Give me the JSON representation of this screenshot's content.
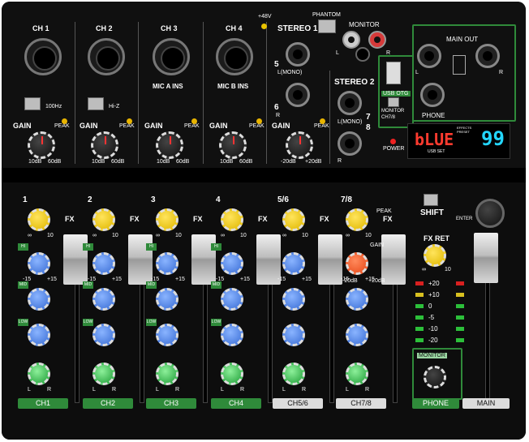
{
  "top": {
    "channels": [
      {
        "name": "CH 1",
        "switch": "100Hz",
        "gain": "GAIN",
        "peak": "PEAK",
        "min": "10dB",
        "max": "60dB"
      },
      {
        "name": "CH 2",
        "switch": "Hi-Z",
        "gain": "GAIN",
        "peak": "PEAK",
        "min": "10dB",
        "max": "60dB"
      },
      {
        "name": "CH 3",
        "sub": "MIC A INS",
        "gain": "GAIN",
        "peak": "PEAK",
        "min": "10dB",
        "max": "60dB"
      },
      {
        "name": "CH 4",
        "sub": "MIC B INS",
        "gain": "GAIN",
        "peak": "PEAK",
        "min": "10dB",
        "max": "60dB"
      }
    ],
    "phantom_volt": "+48V",
    "phantom": "PHANTOM",
    "stereo1": "STEREO 1",
    "stereo1_mono": "L(MONO)",
    "stereo1_r": "R",
    "stereo1_num_a": "5",
    "stereo1_num_b": "6",
    "stereo1_gain": "GAIN",
    "stereo1_peak": "PEAK",
    "stereo1_min": "-20dB",
    "stereo1_max": "+20dB",
    "monitor": "MONITOR",
    "monitor_l": "L",
    "monitor_r": "R",
    "stereo2": "STEREO 2",
    "stereo2_mono": "L(MONO)",
    "stereo2_r": "R",
    "stereo2_num_a": "7",
    "stereo2_num_b": "8",
    "usb": "USB OTG",
    "usb_monitor": "MONITOR",
    "usb_ch": "CH7/8",
    "power": "POWER",
    "main_out": "MAIN OUT",
    "main_l": "L",
    "main_r": "R",
    "phone": "PHONE",
    "display_text": "bLUE",
    "display_num": "99",
    "effects_preset": "EFFECTS PRESET",
    "usb_set": "USB SET"
  },
  "bottom": {
    "channels": [
      {
        "num": "1",
        "label": "CH1"
      },
      {
        "num": "2",
        "label": "CH2"
      },
      {
        "num": "3",
        "label": "CH3"
      },
      {
        "num": "4",
        "label": "CH4"
      },
      {
        "num": "5/6",
        "label": "CH5/6"
      },
      {
        "num": "7/8",
        "label": "CH7/8"
      }
    ],
    "fx": "FX",
    "peak": "PEAK",
    "gain": "GAIN",
    "hi": "HI",
    "mid": "MID",
    "low": "LOW",
    "shift": "SHIFT",
    "enter": "ENTER",
    "fx_ret": "FX RET",
    "monitor": "MONITOR",
    "phone": "PHONE",
    "main": "MAIN",
    "meter": [
      "+20",
      "+10",
      "0",
      "-5",
      "-10",
      "-20"
    ],
    "db_min": "-20dB",
    "db_max": "+20dB",
    "inf": "∞",
    "ten": "10",
    "minus15": "-15",
    "plus15": "+15",
    "pan_l": "L",
    "pan_r": "R"
  },
  "colors": {
    "accent_green": "#2f8a3a",
    "display_red": "#ff3b2f",
    "display_cyan": "#23d6ff",
    "knob_yellow": "#f2cc1a",
    "knob_blue": "#4f86ea",
    "knob_green": "#3fcf55"
  }
}
